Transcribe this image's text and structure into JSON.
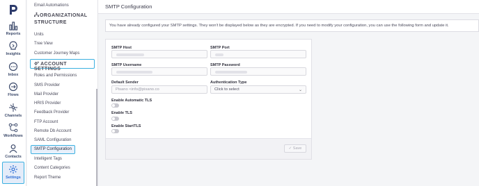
{
  "app": {
    "nav": [
      {
        "label": "Reports",
        "icon": "reports-icon"
      },
      {
        "label": "Insights",
        "icon": "insights-icon"
      },
      {
        "label": "Inbox",
        "icon": "inbox-icon"
      },
      {
        "label": "Flows",
        "icon": "flows-icon"
      },
      {
        "label": "Channels",
        "icon": "channels-icon"
      },
      {
        "label": "Workflows",
        "icon": "workflows-icon"
      },
      {
        "label": "Contacts",
        "icon": "contacts-icon"
      },
      {
        "label": "Settings",
        "icon": "settings-icon",
        "active": true
      }
    ],
    "accent_color": "#3bb0e0"
  },
  "sidebar": {
    "top_item": "Email Automations",
    "org_heading_line1": "ORGANIZATIONAL",
    "org_heading_line2": "STRUCTURE",
    "org_items": [
      "Units",
      "Tree View",
      "Customer Journey Maps"
    ],
    "account_heading": "ACCOUNT SETTINGS",
    "account_items": [
      "Roles and Permissions",
      "SMS Provider",
      "Mail Provider",
      "HRIS Provider",
      "Feedback Provider",
      "FTP Account",
      "Remote Db Account",
      "SAML Configuration",
      "SMTP Configuration",
      "Intelligent Tags",
      "Content Categories",
      "Report Theme"
    ],
    "selected_item": "SMTP Configuration"
  },
  "page": {
    "title": "SMTP Configuration",
    "notice": "You have already configured your SMTP settings. They won't be displayed below as they are encrypted. If you need to modify your configuration, you can use the following form and update it."
  },
  "form": {
    "smtp_host_label": "SMTP Host",
    "smtp_port_label": "SMTP Port",
    "smtp_username_label": "SMTP Username",
    "smtp_password_label": "SMTP Password",
    "default_sender_label": "Default Sender",
    "default_sender_value": "Pisano <info@pisano.co",
    "auth_type_label": "Authentication Type",
    "auth_type_value": "Click to select",
    "enable_auto_tls_label": "Enable Automatic TLS",
    "enable_tls_label": "Enable TLS",
    "enable_starttls_label": "Enable StartTLS",
    "enable_auto_tls": false,
    "enable_tls": false,
    "enable_starttls": false,
    "save_label": "Save"
  }
}
